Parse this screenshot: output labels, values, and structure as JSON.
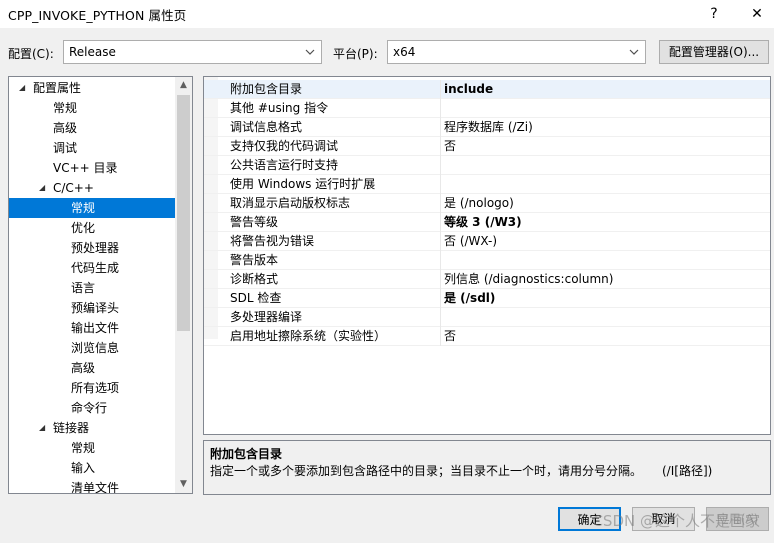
{
  "window": {
    "title": "CPP_INVOKE_PYTHON 属性页",
    "help_label": "?",
    "close_label": "✕"
  },
  "config": {
    "label": "配置(C):",
    "value": "Release",
    "platform_label": "平台(P):",
    "platform_value": "x64",
    "manager_label": "配置管理器(O)..."
  },
  "tree": {
    "items": [
      {
        "label": "配置属性",
        "level": 0,
        "arrow": "◢"
      },
      {
        "label": "常规",
        "level": 1
      },
      {
        "label": "高级",
        "level": 1
      },
      {
        "label": "调试",
        "level": 1
      },
      {
        "label": "VC++ 目录",
        "level": 1
      },
      {
        "label": "C/C++",
        "level": 1,
        "arrow": "◢"
      },
      {
        "label": "常规",
        "level": 2,
        "selected": true
      },
      {
        "label": "优化",
        "level": 2
      },
      {
        "label": "预处理器",
        "level": 2
      },
      {
        "label": "代码生成",
        "level": 2
      },
      {
        "label": "语言",
        "level": 2
      },
      {
        "label": "预编译头",
        "level": 2
      },
      {
        "label": "输出文件",
        "level": 2
      },
      {
        "label": "浏览信息",
        "level": 2
      },
      {
        "label": "高级",
        "level": 2
      },
      {
        "label": "所有选项",
        "level": 2
      },
      {
        "label": "命令行",
        "level": 2
      },
      {
        "label": "链接器",
        "level": 1,
        "arrow": "◢"
      },
      {
        "label": "常规",
        "level": 2
      },
      {
        "label": "输入",
        "level": 2
      },
      {
        "label": "清单文件",
        "level": 2
      }
    ]
  },
  "grid": {
    "rows": [
      {
        "name": "附加包含目录",
        "value": "include",
        "bold": true,
        "selected": true
      },
      {
        "name": "其他 #using 指令",
        "value": ""
      },
      {
        "name": "调试信息格式",
        "value": "程序数据库 (/Zi)"
      },
      {
        "name": "支持仅我的代码调试",
        "value": "否"
      },
      {
        "name": "公共语言运行时支持",
        "value": ""
      },
      {
        "name": "使用 Windows 运行时扩展",
        "value": ""
      },
      {
        "name": "取消显示启动版权标志",
        "value": "是 (/nologo)"
      },
      {
        "name": "警告等级",
        "value": "等级 3 (/W3)",
        "bold": true
      },
      {
        "name": "将警告视为错误",
        "value": "否 (/WX-)"
      },
      {
        "name": "警告版本",
        "value": ""
      },
      {
        "name": "诊断格式",
        "value": "列信息 (/diagnostics:column)"
      },
      {
        "name": "SDL 检查",
        "value": "是 (/sdl)",
        "bold": true
      },
      {
        "name": "多处理器编译",
        "value": ""
      },
      {
        "name": "启用地址擦除系统（实验性）",
        "value": "否"
      }
    ]
  },
  "description": {
    "title": "附加包含目录",
    "text": "指定一个或多个要添加到包含路径中的目录；当目录不止一个时，请用分号分隔。",
    "switch": "(/I[路径])"
  },
  "buttons": {
    "ok": "确定",
    "cancel": "取消",
    "apply": "应用(A)"
  },
  "watermark": "CSDN @这个人不是画家"
}
